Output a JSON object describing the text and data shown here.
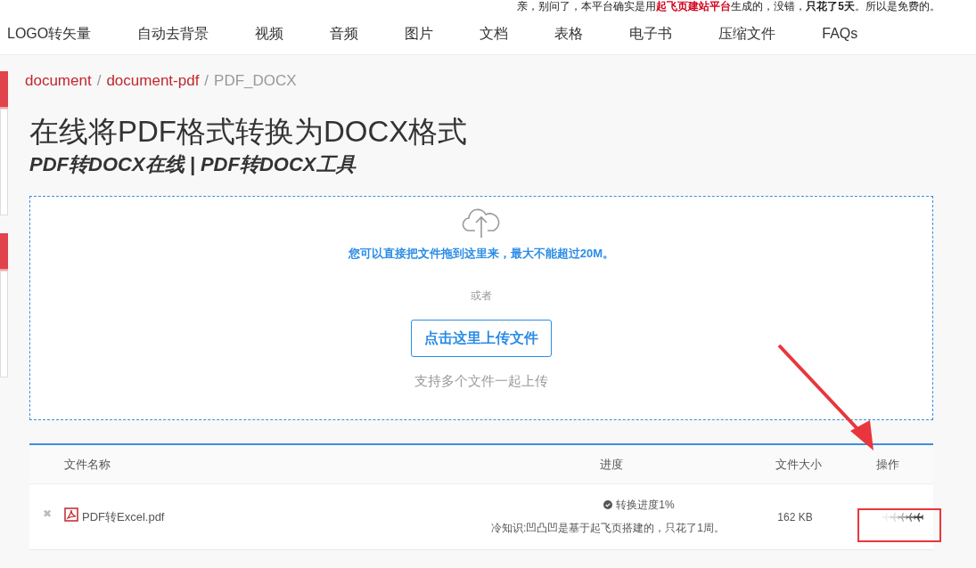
{
  "notice": [
    {
      "kind": "plain",
      "text": "亲，别问了，本平台确实是用"
    },
    {
      "kind": "red",
      "text": "起飞页建站平台"
    },
    {
      "kind": "plain",
      "text": "生成的，没错，"
    },
    {
      "kind": "bold",
      "text": "只花了5天"
    },
    {
      "kind": "plain",
      "text": "。所以是免费的。"
    }
  ],
  "nav": [
    "LOGO转矢量",
    "自动去背景",
    "视频",
    "音频",
    "图片",
    "文档",
    "表格",
    "电子书",
    "压缩文件",
    "FAQs"
  ],
  "breadcrumb": [
    {
      "label": "document",
      "link": true
    },
    {
      "label": "document-pdf",
      "link": true
    },
    {
      "label": "PDF_DOCX",
      "link": false
    }
  ],
  "breadcrumb_separator": "/",
  "remove_glyph": "✖",
  "title": "在线将PDF格式转换为DOCX格式",
  "subtitle": "PDF转DOCX在线 | PDF转DOCX工具",
  "dropzone": {
    "hint": "您可以直接把文件拖到这里来，最大不能超过20M。",
    "or": "或者",
    "button": "点击这里上传文件",
    "note": "支持多个文件一起上传"
  },
  "table": {
    "columns": [
      "文件名称",
      "进度",
      "文件大小",
      "操作"
    ],
    "rows": [
      {
        "name": "PDF转Excel.pdf",
        "progress": "转换进度1%",
        "tip": "冷知识:凹凸凹是基于起飞页搭建的，只花了1周。",
        "size": "162 KB"
      }
    ]
  }
}
